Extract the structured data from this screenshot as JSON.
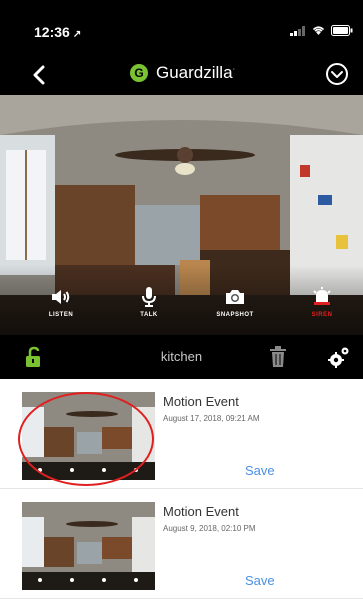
{
  "status_bar": {
    "time": "12:36",
    "location_arrow": "↗"
  },
  "nav": {
    "back_icon": "chevron-left-icon",
    "brand_letter": "G",
    "brand_name": "Guardzilla",
    "brand_mark": "·",
    "menu_icon": "chevron-down-circle-icon"
  },
  "camera": {
    "controls": [
      {
        "label": "LISTEN",
        "icon": "speaker-icon"
      },
      {
        "label": "TALK",
        "icon": "microphone-icon"
      },
      {
        "label": "SNAPSHOT",
        "icon": "camera-icon"
      },
      {
        "label": "SIREN",
        "icon": "alarm-bell-icon"
      }
    ]
  },
  "toolbar": {
    "camera_name": "kitchen",
    "lock_icon": "unlocked-padlock-icon",
    "trash_icon": "trash-icon",
    "settings_icon": "gear-icon"
  },
  "events": [
    {
      "title": "Motion Event",
      "date": "August 17, 2018, 09:21 AM",
      "save_label": "Save"
    },
    {
      "title": "Motion Event",
      "date": "August 9, 2018, 02:10 PM",
      "save_label": "Save"
    }
  ],
  "colors": {
    "brand_green": "#7ac231",
    "accent_blue": "#4a90e2",
    "siren_red": "#e02020",
    "annotation_red": "#e02020"
  }
}
